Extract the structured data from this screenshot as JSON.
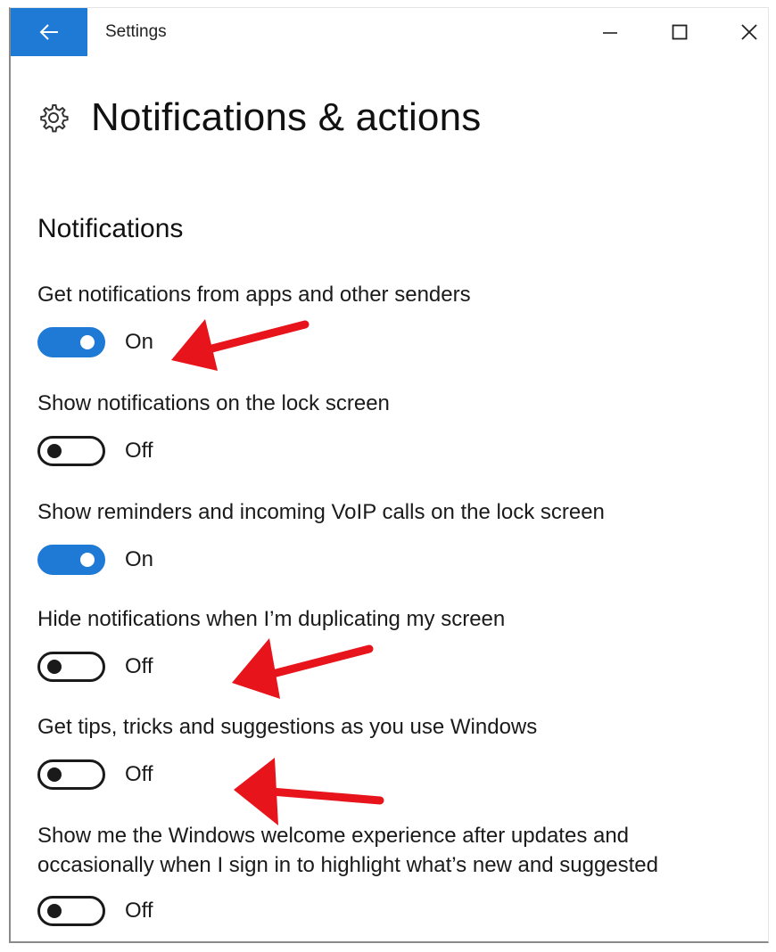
{
  "window": {
    "title": "Settings",
    "accent_color": "#1f7ad6",
    "controls": [
      "minimize-icon",
      "maximize-icon",
      "close-icon"
    ]
  },
  "header": {
    "icon": "gear-icon",
    "title": "Notifications & actions"
  },
  "section": {
    "title": "Notifications"
  },
  "settings": [
    {
      "label": "Get notifications from apps and other senders",
      "state": "On"
    },
    {
      "label": "Show notifications on the lock screen",
      "state": "Off"
    },
    {
      "label": "Show reminders and incoming VoIP calls on the lock screen",
      "state": "On"
    },
    {
      "label": "Hide notifications when I’m duplicating my screen",
      "state": "Off"
    },
    {
      "label": "Get tips, tricks and suggestions as you use Windows",
      "state": "Off"
    },
    {
      "label": "Show me the Windows welcome experience after updates and occasionally when I sign in to highlight what’s new and suggested",
      "state": "Off"
    }
  ],
  "annotations": {
    "arrow_color": "#e8141b",
    "arrows_point_to": [
      "settings.0",
      "settings.3",
      "settings.4"
    ]
  }
}
